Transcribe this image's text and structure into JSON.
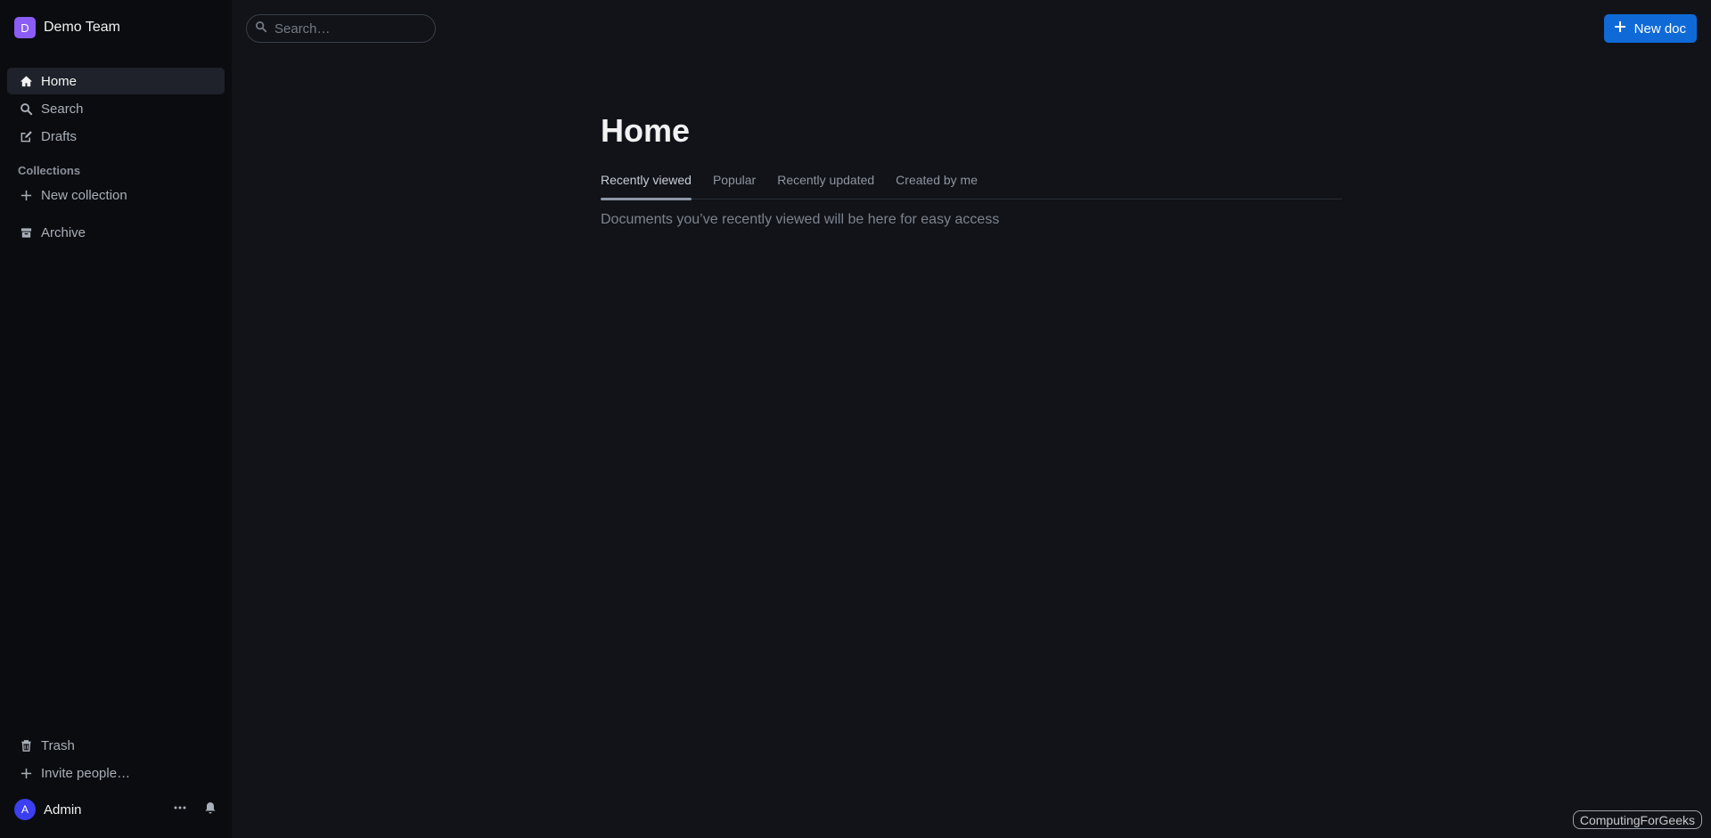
{
  "team": {
    "initial": "D",
    "name": "Demo Team"
  },
  "sidebar": {
    "items": [
      {
        "label": "Home",
        "icon": "home-icon",
        "active": true
      },
      {
        "label": "Search",
        "icon": "search-icon"
      },
      {
        "label": "Drafts",
        "icon": "edit-icon"
      }
    ],
    "collections_title": "Collections",
    "new_collection_label": "New collection",
    "archive_label": "Archive",
    "trash_label": "Trash",
    "invite_label": "Invite people…"
  },
  "user": {
    "initial": "A",
    "name": "Admin"
  },
  "search": {
    "placeholder": "Search…"
  },
  "toolbar": {
    "new_doc_label": "New doc"
  },
  "main": {
    "title": "Home",
    "tabs": [
      {
        "label": "Recently viewed",
        "active": true
      },
      {
        "label": "Popular"
      },
      {
        "label": "Recently updated"
      },
      {
        "label": "Created by me"
      }
    ],
    "empty_message": "Documents you’ve recently viewed will be here for easy access"
  },
  "watermark": "ComputingForGeeks",
  "colors": {
    "accent": "#0f6ad8",
    "team_avatar": "#8b5cf6",
    "user_avatar": "#3b3ff0"
  }
}
